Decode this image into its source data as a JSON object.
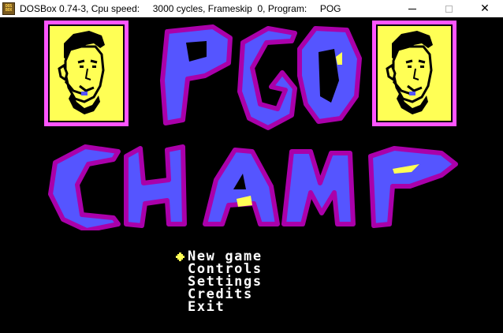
{
  "window": {
    "title": "DOSBox 0.74-3, Cpu speed:     3000 cycles, Frameskip  0, Program:     POG",
    "icon_text_top": "DOS",
    "icon_text_bottom": "BOX",
    "minimize_icon": "minimize-icon",
    "maximize_icon": "maximize-icon",
    "close_icon": "close-icon",
    "close_glyph": "✕"
  },
  "game": {
    "logo_line1": "POG",
    "logo_line2": "CHAMP",
    "colors": {
      "logo_fill": "#5555ff",
      "logo_outline": "#aa00aa",
      "highlight": "#ffff55",
      "frame": "#ff55ff",
      "portrait_bg": "#ffff55"
    },
    "menu": {
      "selected_index": 0,
      "cursor_icon": "star-cursor-icon",
      "items": [
        "New game",
        "Controls",
        "Settings",
        "Credits",
        "Exit"
      ]
    }
  }
}
